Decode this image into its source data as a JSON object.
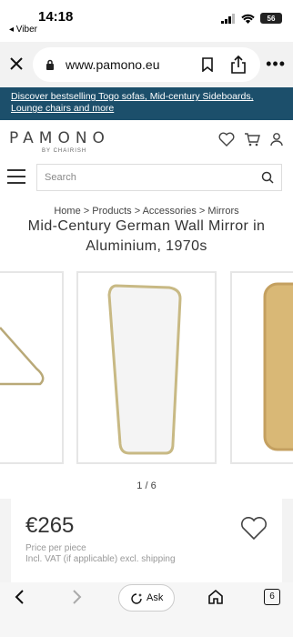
{
  "status": {
    "time": "14:18",
    "back_app": "◂ Viber",
    "battery": "56"
  },
  "browser": {
    "url": "www.pamono.eu",
    "more": "•••"
  },
  "banner": {
    "line1": "Discover bestselling Togo sofas, Mid-century Sideboards,",
    "line2": "Lounge chairs and more"
  },
  "header": {
    "logo": "PAMONO",
    "logo_sub": "BY CHAIRISH"
  },
  "search": {
    "placeholder": "Search"
  },
  "breadcrumb": "Home > Products > Accessories > Mirrors",
  "product": {
    "title": "Mid-Century German Wall Mirror in Aluminium, 1970s",
    "price": "€265",
    "price_note": "Price per piece",
    "vat_note": "Incl. VAT (if applicable) excl. shipping"
  },
  "gallery": {
    "counter": "1 / 6"
  },
  "bottom": {
    "ask_label": "Ask",
    "tab_count": "6"
  },
  "colors": {
    "banner": "#1c4f6b",
    "brass": "#b9a978"
  }
}
